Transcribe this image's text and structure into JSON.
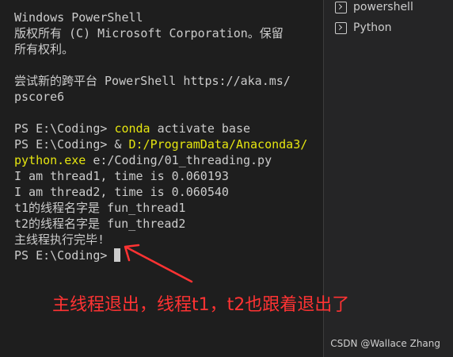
{
  "terminal": {
    "lines": {
      "l0": "Windows PowerShell",
      "l1": "版权所有 (C) Microsoft Corporation。保留",
      "l2": "所有权利。",
      "l3": "",
      "l4": "尝试新的跨平台 PowerShell https://aka.ms/",
      "l5": "pscore6",
      "l6": "",
      "l7_prompt": "PS E:\\Coding> ",
      "l7_cmd": "conda",
      "l7_rest": " activate base",
      "l8_prompt": "PS E:\\Coding> & ",
      "l8_path": "D:/ProgramData/Anaconda3/",
      "l9_exe": "python.exe",
      "l9_rest": " e:/Coding/01_threading.py",
      "l10": "I am thread1, time is 0.060193",
      "l11": "I am thread2, time is 0.060540",
      "l12": "t1的线程名字是 fun_thread1",
      "l13": "t2的线程名字是 fun_thread2",
      "l14": "主线程执行完毕!",
      "l15_prompt": "PS E:\\Coding> "
    }
  },
  "sidebar": {
    "items": [
      {
        "label": "powershell"
      },
      {
        "label": "Python"
      }
    ]
  },
  "annotation": "主线程退出，线程t1，t2也跟着退出了",
  "watermark": "CSDN @Wallace Zhang",
  "colors": {
    "background": "#1e1e1e",
    "text": "#cccccc",
    "highlight": "#e5e510",
    "annotation": "#ff3333"
  }
}
